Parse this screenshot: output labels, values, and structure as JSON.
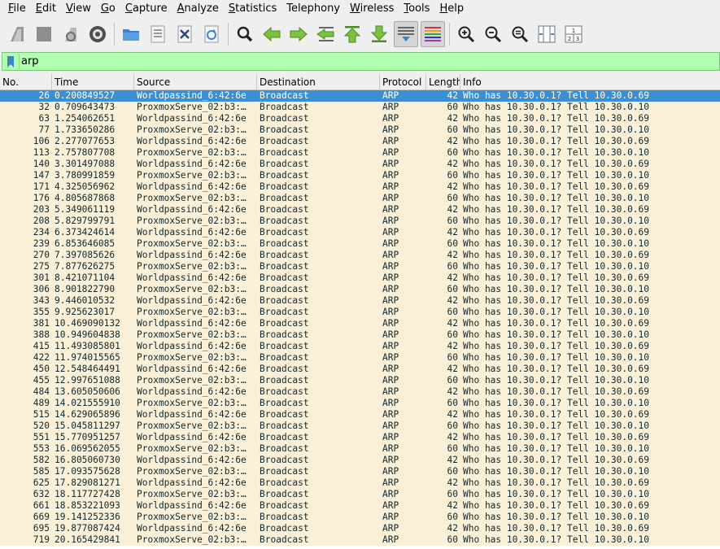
{
  "menu": [
    {
      "u": "F",
      "rest": "ile"
    },
    {
      "u": "E",
      "rest": "dit"
    },
    {
      "u": "V",
      "rest": "iew"
    },
    {
      "u": "G",
      "rest": "o"
    },
    {
      "u": "C",
      "rest": "apture"
    },
    {
      "u": "A",
      "rest": "nalyze"
    },
    {
      "u": "S",
      "rest": "tatistics"
    },
    {
      "u": "",
      "rest": "Telephony",
      "u_index": 4
    },
    {
      "u": "W",
      "rest": "ireless"
    },
    {
      "u": "T",
      "rest": "ools"
    },
    {
      "u": "H",
      "rest": "elp"
    }
  ],
  "toolbar": [
    "start-capture-icon",
    "stop-capture-icon",
    "restart-capture-icon",
    "capture-options-icon",
    "open-file-icon",
    "save-file-icon",
    "close-file-icon",
    "reload-file-icon",
    "find-packet-icon",
    "go-back-icon",
    "go-forward-icon",
    "go-to-packet-icon",
    "go-first-packet-icon",
    "go-last-packet-icon",
    "auto-scroll-icon",
    "colorize-icon",
    "zoom-in-icon",
    "zoom-out-icon",
    "normal-size-icon",
    "resize-columns-icon"
  ],
  "filter": {
    "value": "arp"
  },
  "columns": [
    "No.",
    "Time",
    "Source",
    "Destination",
    "Protocol",
    "Length",
    "Info"
  ],
  "packets": [
    [
      "26",
      "0.200849527",
      "Worldpassind_6:42:6e",
      "Broadcast",
      "ARP",
      "42",
      "Who has 10.30.0.1? Tell 10.30.0.69"
    ],
    [
      "32",
      "0.709643473",
      "ProxmoxServe_02:b3:…",
      "Broadcast",
      "ARP",
      "60",
      "Who has 10.30.0.1? Tell 10.30.0.10"
    ],
    [
      "63",
      "1.254062651",
      "Worldpassind_6:42:6e",
      "Broadcast",
      "ARP",
      "42",
      "Who has 10.30.0.1? Tell 10.30.0.69"
    ],
    [
      "77",
      "1.733650286",
      "ProxmoxServe_02:b3:…",
      "Broadcast",
      "ARP",
      "60",
      "Who has 10.30.0.1? Tell 10.30.0.10"
    ],
    [
      "106",
      "2.277077653",
      "Worldpassind_6:42:6e",
      "Broadcast",
      "ARP",
      "42",
      "Who has 10.30.0.1? Tell 10.30.0.69"
    ],
    [
      "113",
      "2.757807708",
      "ProxmoxServe_02:b3:…",
      "Broadcast",
      "ARP",
      "60",
      "Who has 10.30.0.1? Tell 10.30.0.10"
    ],
    [
      "140",
      "3.301497088",
      "Worldpassind_6:42:6e",
      "Broadcast",
      "ARP",
      "42",
      "Who has 10.30.0.1? Tell 10.30.0.69"
    ],
    [
      "147",
      "3.780991859",
      "ProxmoxServe_02:b3:…",
      "Broadcast",
      "ARP",
      "60",
      "Who has 10.30.0.1? Tell 10.30.0.10"
    ],
    [
      "171",
      "4.325056962",
      "Worldpassind_6:42:6e",
      "Broadcast",
      "ARP",
      "42",
      "Who has 10.30.0.1? Tell 10.30.0.69"
    ],
    [
      "176",
      "4.805687868",
      "ProxmoxServe_02:b3:…",
      "Broadcast",
      "ARP",
      "60",
      "Who has 10.30.0.1? Tell 10.30.0.10"
    ],
    [
      "203",
      "5.349061119",
      "Worldpassind_6:42:6e",
      "Broadcast",
      "ARP",
      "42",
      "Who has 10.30.0.1? Tell 10.30.0.69"
    ],
    [
      "208",
      "5.829799791",
      "ProxmoxServe_02:b3:…",
      "Broadcast",
      "ARP",
      "60",
      "Who has 10.30.0.1? Tell 10.30.0.10"
    ],
    [
      "234",
      "6.373424614",
      "Worldpassind_6:42:6e",
      "Broadcast",
      "ARP",
      "42",
      "Who has 10.30.0.1? Tell 10.30.0.69"
    ],
    [
      "239",
      "6.853646085",
      "ProxmoxServe_02:b3:…",
      "Broadcast",
      "ARP",
      "60",
      "Who has 10.30.0.1? Tell 10.30.0.10"
    ],
    [
      "270",
      "7.397085626",
      "Worldpassind_6:42:6e",
      "Broadcast",
      "ARP",
      "42",
      "Who has 10.30.0.1? Tell 10.30.0.69"
    ],
    [
      "275",
      "7.877626275",
      "ProxmoxServe_02:b3:…",
      "Broadcast",
      "ARP",
      "60",
      "Who has 10.30.0.1? Tell 10.30.0.10"
    ],
    [
      "301",
      "8.421071104",
      "Worldpassind_6:42:6e",
      "Broadcast",
      "ARP",
      "42",
      "Who has 10.30.0.1? Tell 10.30.0.69"
    ],
    [
      "306",
      "8.901822790",
      "ProxmoxServe_02:b3:…",
      "Broadcast",
      "ARP",
      "60",
      "Who has 10.30.0.1? Tell 10.30.0.10"
    ],
    [
      "343",
      "9.446010532",
      "Worldpassind_6:42:6e",
      "Broadcast",
      "ARP",
      "42",
      "Who has 10.30.0.1? Tell 10.30.0.69"
    ],
    [
      "355",
      "9.925623017",
      "ProxmoxServe_02:b3:…",
      "Broadcast",
      "ARP",
      "60",
      "Who has 10.30.0.1? Tell 10.30.0.10"
    ],
    [
      "381",
      "10.469090132",
      "Worldpassind_6:42:6e",
      "Broadcast",
      "ARP",
      "42",
      "Who has 10.30.0.1? Tell 10.30.0.69"
    ],
    [
      "388",
      "10.949604838",
      "ProxmoxServe_02:b3:…",
      "Broadcast",
      "ARP",
      "60",
      "Who has 10.30.0.1? Tell 10.30.0.10"
    ],
    [
      "415",
      "11.493085801",
      "Worldpassind_6:42:6e",
      "Broadcast",
      "ARP",
      "42",
      "Who has 10.30.0.1? Tell 10.30.0.69"
    ],
    [
      "422",
      "11.974015565",
      "ProxmoxServe_02:b3:…",
      "Broadcast",
      "ARP",
      "60",
      "Who has 10.30.0.1? Tell 10.30.0.10"
    ],
    [
      "450",
      "12.548464491",
      "Worldpassind_6:42:6e",
      "Broadcast",
      "ARP",
      "42",
      "Who has 10.30.0.1? Tell 10.30.0.69"
    ],
    [
      "455",
      "12.997651088",
      "ProxmoxServe_02:b3:…",
      "Broadcast",
      "ARP",
      "60",
      "Who has 10.30.0.1? Tell 10.30.0.10"
    ],
    [
      "484",
      "13.605050606",
      "Worldpassind_6:42:6e",
      "Broadcast",
      "ARP",
      "42",
      "Who has 10.30.0.1? Tell 10.30.0.69"
    ],
    [
      "489",
      "14.021555910",
      "ProxmoxServe_02:b3:…",
      "Broadcast",
      "ARP",
      "60",
      "Who has 10.30.0.1? Tell 10.30.0.10"
    ],
    [
      "515",
      "14.629065896",
      "Worldpassind_6:42:6e",
      "Broadcast",
      "ARP",
      "42",
      "Who has 10.30.0.1? Tell 10.30.0.69"
    ],
    [
      "520",
      "15.045811297",
      "ProxmoxServe_02:b3:…",
      "Broadcast",
      "ARP",
      "60",
      "Who has 10.30.0.1? Tell 10.30.0.10"
    ],
    [
      "551",
      "15.770951257",
      "Worldpassind_6:42:6e",
      "Broadcast",
      "ARP",
      "42",
      "Who has 10.30.0.1? Tell 10.30.0.69"
    ],
    [
      "553",
      "16.069562055",
      "ProxmoxServe_02:b3:…",
      "Broadcast",
      "ARP",
      "60",
      "Who has 10.30.0.1? Tell 10.30.0.10"
    ],
    [
      "582",
      "16.805060730",
      "Worldpassind_6:42:6e",
      "Broadcast",
      "ARP",
      "42",
      "Who has 10.30.0.1? Tell 10.30.0.69"
    ],
    [
      "585",
      "17.093575628",
      "ProxmoxServe_02:b3:…",
      "Broadcast",
      "ARP",
      "60",
      "Who has 10.30.0.1? Tell 10.30.0.10"
    ],
    [
      "625",
      "17.829081271",
      "Worldpassind_6:42:6e",
      "Broadcast",
      "ARP",
      "42",
      "Who has 10.30.0.1? Tell 10.30.0.69"
    ],
    [
      "632",
      "18.117727428",
      "ProxmoxServe_02:b3:…",
      "Broadcast",
      "ARP",
      "60",
      "Who has 10.30.0.1? Tell 10.30.0.10"
    ],
    [
      "661",
      "18.853221093",
      "Worldpassind_6:42:6e",
      "Broadcast",
      "ARP",
      "42",
      "Who has 10.30.0.1? Tell 10.30.0.69"
    ],
    [
      "669",
      "19.141252336",
      "ProxmoxServe_02:b3:…",
      "Broadcast",
      "ARP",
      "60",
      "Who has 10.30.0.1? Tell 10.30.0.10"
    ],
    [
      "695",
      "19.877087424",
      "Worldpassind_6:42:6e",
      "Broadcast",
      "ARP",
      "42",
      "Who has 10.30.0.1? Tell 10.30.0.69"
    ],
    [
      "719",
      "20.165429841",
      "ProxmoxServe_02:b3:…",
      "Broadcast",
      "ARP",
      "60",
      "Who has 10.30.0.1? Tell 10.30.0.10"
    ]
  ],
  "selected_row": 0,
  "colors": {
    "row_bg": "#faf0d7",
    "row_fg": "#12272e",
    "selected_bg": "#3c8fd0",
    "filter_bg": "#afffaf"
  }
}
